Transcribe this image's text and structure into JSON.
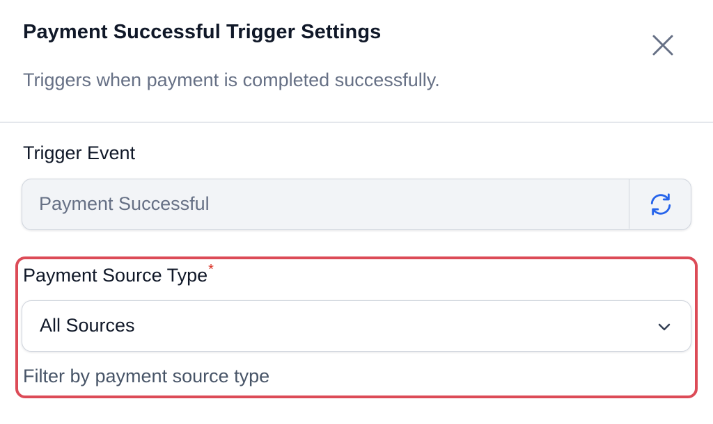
{
  "dialog": {
    "title": "Payment Successful Trigger Settings",
    "subtitle": "Triggers when payment is completed successfully.",
    "close_icon": "close-icon"
  },
  "trigger_event": {
    "label": "Trigger Event",
    "value": "Payment Successful",
    "refresh_icon": "refresh-icon"
  },
  "payment_source": {
    "label": "Payment Source Type",
    "required_marker": "*",
    "selected": "All Sources",
    "dropdown_icon": "chevron-down-icon",
    "hint": "Filter by payment source type"
  },
  "colors": {
    "highlight": "#dc4b57",
    "required": "#d92d20",
    "refresh_icon": "#2563eb",
    "disabled_bg": "#f2f4f7"
  }
}
